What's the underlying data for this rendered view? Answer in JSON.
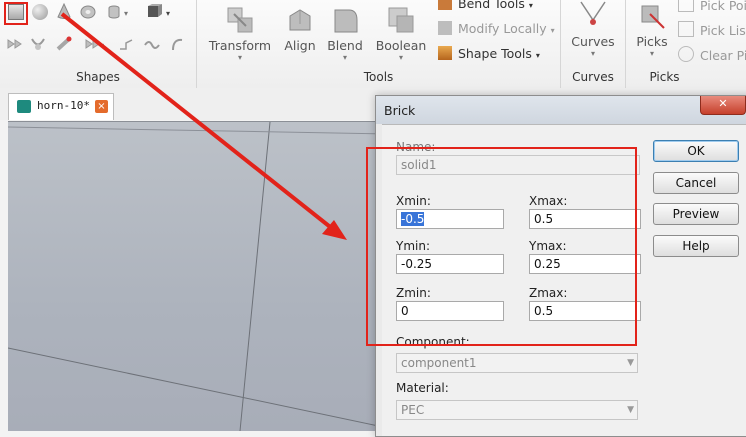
{
  "ribbon": {
    "groups": {
      "shapes": "Shapes",
      "tools": "Tools",
      "curves": "Curves",
      "picks": "Picks"
    },
    "tools_buttons": {
      "transform": "Transform",
      "align": "Align",
      "blend": "Blend",
      "boolean": "Boolean"
    },
    "tools_list": {
      "bend": "Bend Tools",
      "modify": "Modify Locally",
      "shape": "Shape Tools"
    },
    "curves_button": "Curves",
    "picks_button": "Picks",
    "picks_list": {
      "pick_points": "Pick Poin",
      "pick_lists": "Pick Lists",
      "clear_picks": "Clear Pic"
    }
  },
  "document_tab": {
    "label": "horn-10*",
    "close": "×"
  },
  "dialog": {
    "title": "Brick",
    "close": "✕",
    "name_label": "Name:",
    "name_value": "solid1",
    "xmin_label": "Xmin:",
    "xmin_value": "-0.5",
    "xmax_label": "Xmax:",
    "xmax_value": "0.5",
    "ymin_label": "Ymin:",
    "ymin_value": "-0.25",
    "ymax_label": "Ymax:",
    "ymax_value": "0.25",
    "zmin_label": "Zmin:",
    "zmin_value": "0",
    "zmax_label": "Zmax:",
    "zmax_value": "0.5",
    "component_label": "Component:",
    "component_value": "component1",
    "material_label": "Material:",
    "material_value": "PEC",
    "buttons": {
      "ok": "OK",
      "cancel": "Cancel",
      "preview": "Preview",
      "help": "Help"
    }
  },
  "colors": {
    "annotation_red": "#e2231a",
    "accent_blue": "#3874d8"
  }
}
